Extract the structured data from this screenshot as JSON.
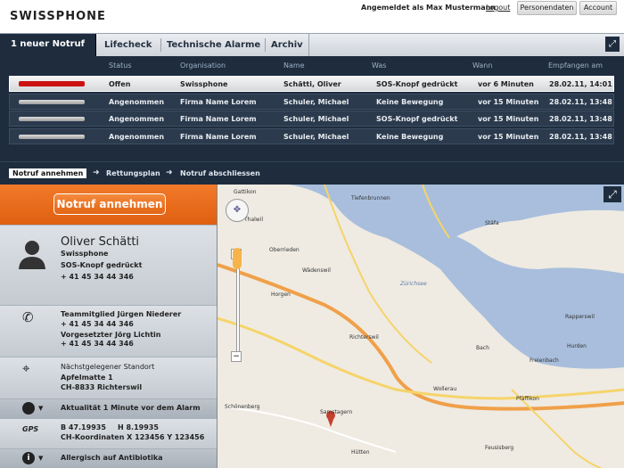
{
  "header": {
    "logo": "SWISSPHONE",
    "logged_in_label": "Angemeldet als Max Mustermann",
    "logout": "Logout",
    "btn_personal": "Personendaten",
    "btn_account": "Account"
  },
  "tabs": [
    "1 neuer Notruf",
    "Lifecheck",
    "Technische Alarme",
    "Archiv"
  ],
  "table": {
    "headers": [
      "Status",
      "Organisation",
      "Name",
      "Was",
      "Wann",
      "Empfangen am"
    ],
    "rows": [
      {
        "status": "Offen",
        "org": "Swissphone",
        "name": "Schätti, Oliver",
        "was": "SOS-Knopf gedrückt",
        "wann": "vor 6 Minuten",
        "received": "28.02.11, 14:01"
      },
      {
        "status": "Angenommen",
        "org": "Firma Name Lorem",
        "name": "Schuler, Michael",
        "was": "Keine Bewegung",
        "wann": "vor 15 Minuten",
        "received": "28.02.11, 13:48"
      },
      {
        "status": "Angenommen",
        "org": "Firma Name Lorem",
        "name": "Schuler, Michael",
        "was": "SOS-Knopf gedrückt",
        "wann": "vor 15 Minuten",
        "received": "28.02.11, 13:48"
      },
      {
        "status": "Angenommen",
        "org": "Firma Name Lorem",
        "name": "Schuler, Michael",
        "was": "Keine Bewegung",
        "wann": "vor 15 Minuten",
        "received": "28.02.11, 13:48"
      }
    ]
  },
  "steps": [
    "Notruf annehmen",
    "Rettungsplan",
    "Notruf abschliessen"
  ],
  "left": {
    "accept_button": "Notruf annehmen",
    "person_name": "Oliver Schätti",
    "person_org": "Swissphone",
    "person_event": "SOS-Knopf gedrückt",
    "person_phone": "+ 41 45 34 44 346",
    "contact1_label": "Teammitglied Jürgen Niederer",
    "contact1_phone": "+ 41 45 34 44 346",
    "contact2_label": "Vorgesetzter Jörg Lichtin",
    "contact2_phone": "+ 41 45 34 44 346",
    "loc_title": "Nächstgelegener Standort",
    "loc_street": "Apfelmatte 1",
    "loc_city": "CH-8833 Richterswil",
    "actuality": "Aktualität 1 Minute vor dem Alarm",
    "gps_label": "GPS",
    "gps_b": "B 47.19935",
    "gps_h": "H 8.19935",
    "gps_ch": "CH-Koordinaten X 123456 Y 123456",
    "allergy": "Allergisch auf Antibiotika"
  },
  "map_labels": {
    "gattikon": "Gattikon",
    "thalwil": "Thalwil",
    "oberrieden": "Oberrieden",
    "horgen": "Horgen",
    "schonenberg": "Schönenberg",
    "richterswil": "Richterswil",
    "waedenswil": "Wädenswil",
    "wollerau": "Wollerau",
    "samstagern": "Samstagern",
    "freienbach": "Freienbach",
    "pfaeffikon": "Pfäffikon",
    "rapperswil": "Rapperswil",
    "stafa": "Stäfa",
    "hurden": "Hurden",
    "bach": "Bach",
    "hutten": "Hütten",
    "feusisberg": "Feusisberg",
    "tiefenbrunnen": "Tiefenbrunnen",
    "zurichsee": "Zürichsee"
  },
  "colors": {
    "dark_panel": "#1e2c3e",
    "orange": "#ef6e1f",
    "alert_red": "#cc1111",
    "water": "#a8bedc"
  }
}
